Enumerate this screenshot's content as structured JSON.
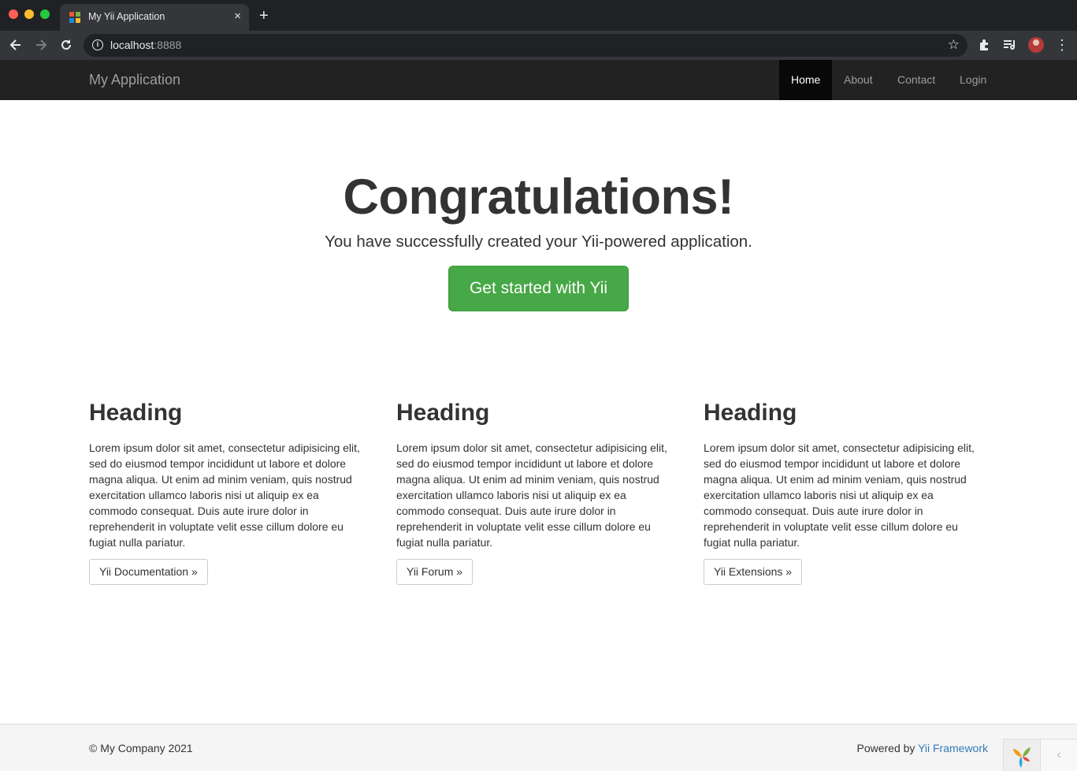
{
  "browser": {
    "tab_title": "My Yii Application",
    "tab_close_icon": "×",
    "new_tab_icon": "+",
    "url_host": "localhost",
    "url_port": ":8888",
    "icons": [
      "back-arrow-icon",
      "forward-arrow-icon",
      "reload-icon",
      "info-icon",
      "star-icon",
      "extensions-icon",
      "media-control-icon",
      "profile-avatar",
      "kebab-menu-icon"
    ]
  },
  "navbar": {
    "brand": "My Application",
    "items": [
      {
        "label": "Home",
        "active": true
      },
      {
        "label": "About",
        "active": false
      },
      {
        "label": "Contact",
        "active": false
      },
      {
        "label": "Login",
        "active": false
      }
    ],
    "background": "#222222"
  },
  "jumbotron": {
    "title": "Congratulations!",
    "lead": "You have successfully created your Yii-powered application.",
    "button_label": "Get started with Yii",
    "button_color": "#46a846"
  },
  "columns": [
    {
      "heading": "Heading",
      "text": "Lorem ipsum dolor sit amet, consectetur adipisicing elit, sed do eiusmod tempor incididunt ut labore et dolore magna aliqua. Ut enim ad minim veniam, quis nostrud exercitation ullamco laboris nisi ut aliquip ex ea commodo consequat. Duis aute irure dolor in reprehenderit in voluptate velit esse cillum dolore eu fugiat nulla pariatur.",
      "button_label": "Yii Documentation »"
    },
    {
      "heading": "Heading",
      "text": "Lorem ipsum dolor sit amet, consectetur adipisicing elit, sed do eiusmod tempor incididunt ut labore et dolore magna aliqua. Ut enim ad minim veniam, quis nostrud exercitation ullamco laboris nisi ut aliquip ex ea commodo consequat. Duis aute irure dolor in reprehenderit in voluptate velit esse cillum dolore eu fugiat nulla pariatur.",
      "button_label": "Yii Forum »"
    },
    {
      "heading": "Heading",
      "text": "Lorem ipsum dolor sit amet, consectetur adipisicing elit, sed do eiusmod tempor incididunt ut labore et dolore magna aliqua. Ut enim ad minim veniam, quis nostrud exercitation ullamco laboris nisi ut aliquip ex ea commodo consequat. Duis aute irure dolor in reprehenderit in voluptate velit esse cillum dolore eu fugiat nulla pariatur.",
      "button_label": "Yii Extensions »"
    }
  ],
  "footer": {
    "copyright": "© My Company 2021",
    "powered_prefix": "Powered by ",
    "powered_link": "Yii Framework",
    "debug_toggle_icon": "‹"
  }
}
